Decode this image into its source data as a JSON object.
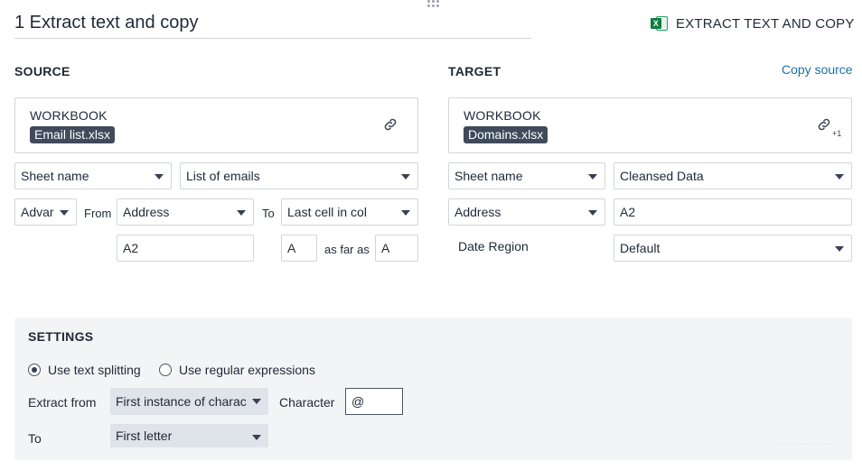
{
  "header": {
    "step_title": "1 Extract text and copy",
    "action_label": "EXTRACT TEXT AND COPY",
    "action_icon": "excel-icon",
    "excel_letter": "X"
  },
  "source": {
    "heading": "SOURCE",
    "workbook_label": "WORKBOOK",
    "workbook_file": "Email list.xlsx",
    "sheet_mode": "Sheet name",
    "sheet_value": "List of emails",
    "range_mode": "Advar",
    "from_label": "From",
    "from_mode": "Address",
    "to_label": "To",
    "to_mode": "Last cell in col",
    "from_address": "A2",
    "to_col": "A",
    "as_far_as_label": "as far as",
    "as_far_as_value": "A"
  },
  "target": {
    "heading": "TARGET",
    "copy_source_label": "Copy source",
    "workbook_label": "WORKBOOK",
    "workbook_file": "Domains.xlsx",
    "link_count": "+1",
    "sheet_mode": "Sheet name",
    "sheet_value": "Cleansed Data",
    "range_mode": "Address",
    "address_value": "A2",
    "date_region_label": "Date Region",
    "date_region_value": "Default"
  },
  "settings": {
    "heading": "SETTINGS",
    "radio_text_splitting": "Use text splitting",
    "radio_regex": "Use regular expressions",
    "selected_mode": "text_splitting",
    "extract_from_label": "Extract from",
    "extract_from_value": "First instance of charac",
    "character_label": "Character",
    "character_value": "@",
    "to_label": "To",
    "to_value": "First letter"
  },
  "colors": {
    "accent_link": "#1d6fa8",
    "file_chip": "#3f4a5a",
    "excel_green": "#107c41",
    "settings_bg": "#f3f4f6"
  }
}
